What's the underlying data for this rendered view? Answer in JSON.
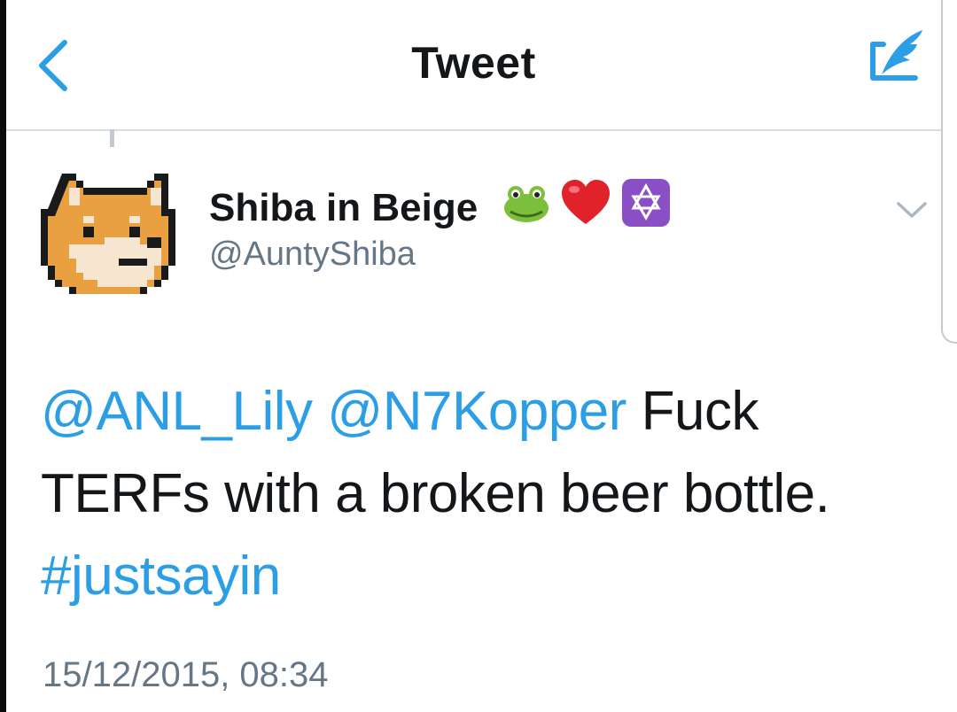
{
  "header": {
    "title": "Tweet"
  },
  "tweet": {
    "author": {
      "name": "Shiba in Beige",
      "handle": "@AuntyShiba"
    },
    "name_emojis": [
      "frog-face",
      "red-heart",
      "star-of-david"
    ],
    "mentions": [
      "@ANL_Lily",
      "@N7Kopper"
    ],
    "text_line1": " Fuck",
    "text_line2": "TERFs with a broken beer bottle.",
    "hashtag": "#justsayin",
    "timestamp": "15/12/2015, 08:34"
  },
  "colors": {
    "link": "#2b9ee6",
    "secondary_text": "#657786",
    "primary_text": "#14171a",
    "divider": "#d7dde3"
  }
}
